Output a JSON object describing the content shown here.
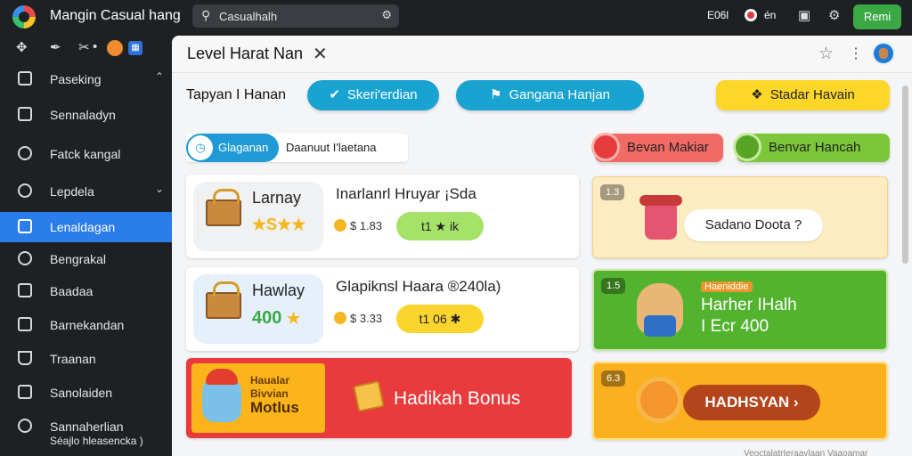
{
  "topbar": {
    "app_title": "Mangin Casual hang",
    "search_placeholder": "Casualhalh",
    "item1": "E06l",
    "item2": "én",
    "button": "Remi"
  },
  "sidebar": {
    "items": [
      {
        "label": "Paseking"
      },
      {
        "label": "Sennaladyn"
      },
      {
        "label": "Fatck kangal"
      },
      {
        "label": "Lepdela"
      },
      {
        "label": "Lenaldagan"
      },
      {
        "label": "Bengrakal"
      },
      {
        "label": "Baadaa"
      },
      {
        "label": "Barnekandan"
      },
      {
        "label": "Traanan"
      },
      {
        "label": "Sanolaiden"
      },
      {
        "label": "Sannaherlian",
        "sub": "Séajlo hleasencka )"
      }
    ]
  },
  "main": {
    "title": "Level Harat Nan",
    "filter_label": "Tapyan I Hanan",
    "pills": [
      "Skeri'erdian",
      "Gangana Hanjan",
      "Stadar Havain"
    ],
    "segment": {
      "left": "Glaganan",
      "right": "Daanuut I'laetana"
    },
    "buttons": [
      "Bevan Makiar",
      "Benvar Hancah"
    ]
  },
  "cards": [
    {
      "name": "Larnay",
      "badge": "★S★★",
      "desc": "Inarlanrl Hruyar ¡Sda",
      "price": "$ 1.83",
      "pill": "t1 ★ ik"
    },
    {
      "name": "Hawlay",
      "badge": "400",
      "desc": "Glapiknsl Haara ®240la)",
      "price": "$ 3.33",
      "pill": "t1 06 ✱"
    }
  ],
  "bonus": {
    "left_line1": "Haualar",
    "left_line2": "Bivvian",
    "left_line3": "Motlus",
    "title": "Hadikah Bonus"
  },
  "side": [
    {
      "tag": "1.3",
      "bubble": "Sadano Doota ?"
    },
    {
      "tag": "1.5",
      "tag2": "Haeniddie",
      "title": "Harher IHalh",
      "sub": "I Ecr 400"
    },
    {
      "tag": "6.3",
      "button": "HADHSYAN"
    }
  ],
  "footer": "Veoctalatrteraavlaan Vaaoamar",
  "colors": {
    "accent": "#2b7de9",
    "primary_green": "#3aa845",
    "pill_blue": "#18a3d1",
    "pill_yellow": "#fcd628",
    "bonus_red": "#e93b3b"
  }
}
